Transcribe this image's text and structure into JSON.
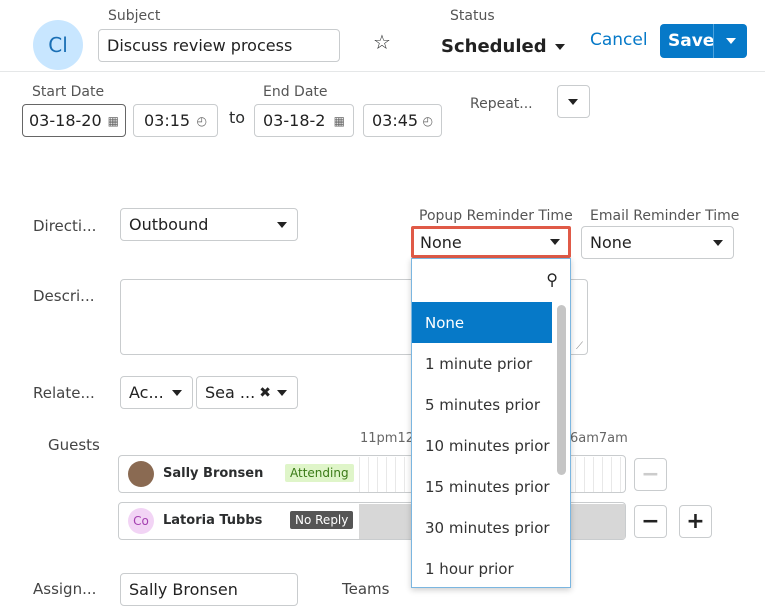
{
  "header": {
    "avatar_initials": "Cl",
    "subject_label": "Subject",
    "subject_value": "Discuss review process",
    "status_label": "Status",
    "status_value": "Scheduled",
    "cancel_label": "Cancel",
    "save_label": "Save"
  },
  "dates": {
    "start_label": "Start Date",
    "start_date": "03-18-20",
    "start_time": "03:15",
    "to_label": "to",
    "end_label": "End Date",
    "end_date": "03-18-2",
    "end_time": "03:45",
    "repeat_label": "Repeat..."
  },
  "direction": {
    "label": "Directi...",
    "value": "Outbound"
  },
  "reminders": {
    "popup_label": "Popup Reminder Time",
    "popup_value": "None",
    "email_label": "Email Reminder Time",
    "email_value": "None"
  },
  "dropdown": {
    "search_placeholder": "",
    "options": [
      "None",
      "1 minute prior",
      "5 minutes prior",
      "10 minutes prior",
      "15 minutes prior",
      "30 minutes prior",
      "1 hour prior"
    ],
    "selected_index": 0
  },
  "description": {
    "label": "Descri..."
  },
  "related": {
    "label": "Relate...",
    "module_value": "Ac...",
    "record_value": "Sea ..."
  },
  "guests": {
    "label": "Guests",
    "timeline_labels": [
      "11pm12",
      "6am7am"
    ],
    "list": [
      {
        "initials": "",
        "name": "Sally Bronsen",
        "status": "Attending"
      },
      {
        "initials": "Co",
        "name": "Latoria Tubbs",
        "status": "No Reply"
      }
    ]
  },
  "assigned": {
    "label": "Assign...",
    "value": "Sally Bronsen",
    "teams_label": "Teams"
  },
  "colors": {
    "accent": "#0679c8",
    "highlight": "#e05a47",
    "attending_bg": "#dff5c9",
    "noreply_bg": "#555555"
  }
}
